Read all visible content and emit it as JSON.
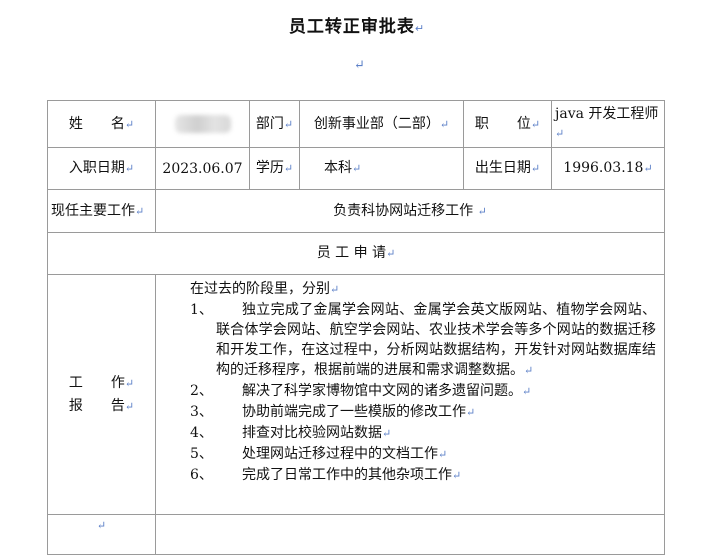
{
  "doc": {
    "title": "员工转正审批表",
    "return_mark": "↵"
  },
  "info": {
    "name_label": "姓　　名",
    "name_value": "",
    "dept_label": "部门",
    "dept_value": "创新事业部（二部）",
    "position_label": "职　　位",
    "position_value": "java 开发工程师",
    "join_date_label": "入职日期",
    "join_date_value": "2023.06.07",
    "education_label": "学历",
    "education_value": "本科",
    "birth_date_label": "出生日期",
    "birth_date_value": "1996.03.18",
    "main_work_label": "现任主要工作",
    "main_work_value": "负责科协网站迁移工作"
  },
  "application": {
    "header": "员 工 申 请",
    "report_label_line1": "工　　作",
    "report_label_line2": "报　　告",
    "intro": "在过去的阶段里，分别",
    "items": [
      {
        "num": "1、",
        "text": "独立完成了金属学会网站、金属学会英文版网站、植物学会网站、联合体学会网站、航空学会网站、农业技术学会等多个网站的数据迁移和开发工作，在这过程中，分析网站数据结构，开发针对网站数据库结构的迁移程序，根据前端的进展和需求调整数据。"
      },
      {
        "num": "2、",
        "text": "解决了科学家博物馆中文网的诸多遗留问题。"
      },
      {
        "num": "3、",
        "text": "协助前端完成了一些模版的修改工作"
      },
      {
        "num": "4、",
        "text": "排查对比校验网站数据"
      },
      {
        "num": "5、",
        "text": "处理网站迁移过程中的文档工作"
      },
      {
        "num": "6、",
        "text": "完成了日常工作中的其他杂项工作"
      }
    ]
  }
}
